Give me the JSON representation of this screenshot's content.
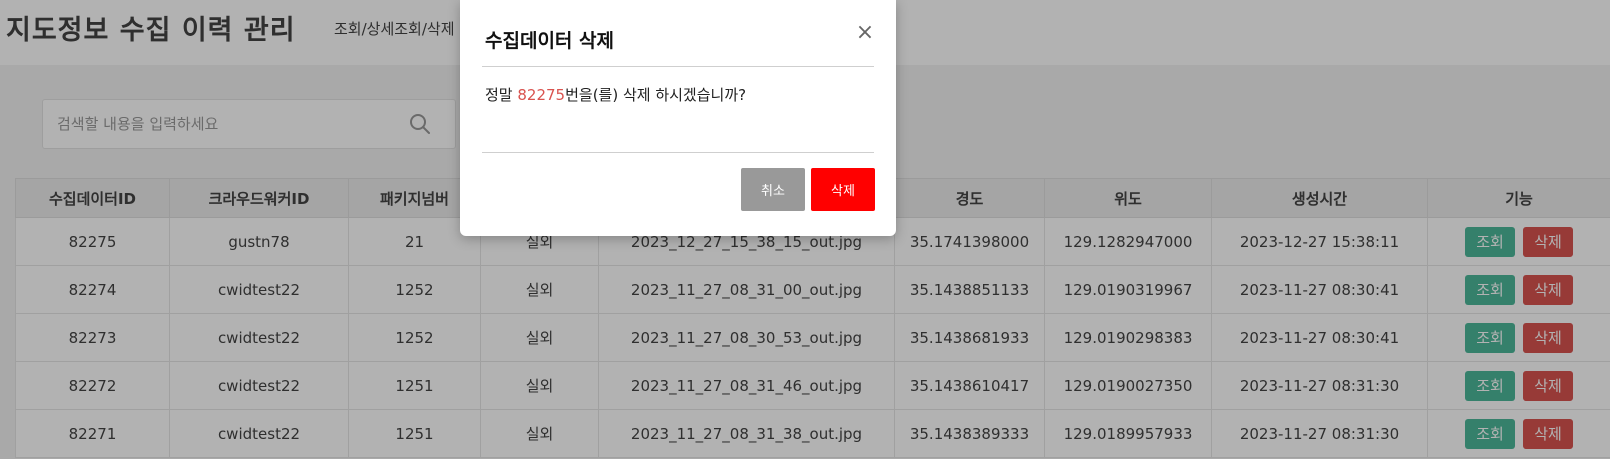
{
  "page": {
    "title": "지도정보 수집 이력 관리",
    "breadcrumb": "조회/상세조회/삭제"
  },
  "search": {
    "placeholder": "검색할 내용을 입력하세요",
    "value": ""
  },
  "table": {
    "columns": [
      "수집데이터ID",
      "크라우드워커ID",
      "패키지넘버",
      "",
      "",
      "경도",
      "위도",
      "생성시간",
      "기능"
    ],
    "rows": [
      [
        "82275",
        "gustn78",
        "21",
        "실외",
        "2023_12_27_15_38_15_out.jpg",
        "35.1741398000",
        "129.1282947000",
        "2023-12-27 15:38:11"
      ],
      [
        "82274",
        "cwidtest22",
        "1252",
        "실외",
        "2023_11_27_08_31_00_out.jpg",
        "35.1438851133",
        "129.0190319967",
        "2023-11-27 08:30:41"
      ],
      [
        "82273",
        "cwidtest22",
        "1252",
        "실외",
        "2023_11_27_08_30_53_out.jpg",
        "35.1438681933",
        "129.0190298383",
        "2023-11-27 08:30:41"
      ],
      [
        "82272",
        "cwidtest22",
        "1251",
        "실외",
        "2023_11_27_08_31_46_out.jpg",
        "35.1438610417",
        "129.0190027350",
        "2023-11-27 08:31:30"
      ],
      [
        "82271",
        "cwidtest22",
        "1251",
        "실외",
        "2023_11_27_08_31_38_out.jpg",
        "35.1438389333",
        "129.0189957933",
        "2023-11-27 08:31:30"
      ]
    ],
    "actions": {
      "view_label": "조회",
      "delete_label": "삭제"
    }
  },
  "modal": {
    "title": "수집데이터 삭제",
    "close_glyph": "×",
    "message_prefix": "정말 ",
    "message_id": "82275",
    "message_suffix": "번을(를) 삭제 하시겠습니까?",
    "cancel_label": "취소",
    "confirm_label": "삭제"
  },
  "colors": {
    "view_button": "#4cb89a",
    "delete_button": "#d9534f",
    "modal_confirm": "#ff0000",
    "modal_cancel": "#999999",
    "highlight_id": "#d9534f"
  },
  "icons": {
    "search": "search-icon",
    "close": "close-icon"
  }
}
